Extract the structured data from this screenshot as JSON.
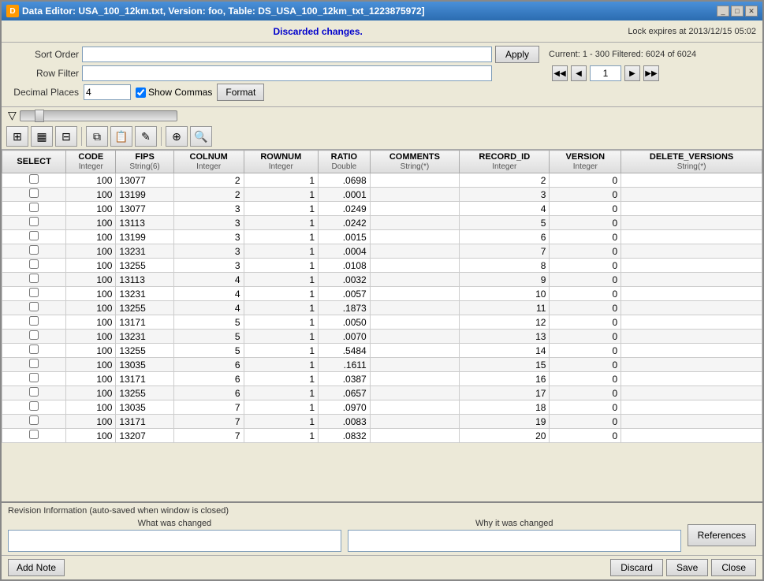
{
  "window": {
    "title": "Data Editor: USA_100_12km.txt, Version: foo, Table: DS_USA_100_12km_txt_1223875972]",
    "icon": "D"
  },
  "title_controls": [
    "_",
    "□",
    "✕"
  ],
  "top_bar": {
    "message": "Discarded changes.",
    "lock_info": "Lock expires at 2013/12/15 05:02"
  },
  "sort_order": {
    "label": "Sort Order",
    "value": "",
    "placeholder": ""
  },
  "row_filter": {
    "label": "Row Filter",
    "value": "",
    "placeholder": ""
  },
  "apply_button": "Apply",
  "navigation": {
    "current_info": "Current: 1 - 300  Filtered: 6024 of 6024",
    "page_value": "1",
    "first_label": "◀◀",
    "prev_label": "◀",
    "next_label": "▶",
    "last_label": "▶▶"
  },
  "decimal_places": {
    "label": "Decimal Places",
    "value": "4"
  },
  "show_commas": {
    "label": "Show Commas",
    "checked": true
  },
  "format_button": "Format",
  "toolbar_buttons": [
    {
      "name": "grid-icon",
      "symbol": "⊞"
    },
    {
      "name": "table-icon",
      "symbol": "▦"
    },
    {
      "name": "table2-icon",
      "symbol": "⊟"
    },
    {
      "name": "copy-icon",
      "symbol": "⧉"
    },
    {
      "name": "paste-icon",
      "symbol": "📋"
    },
    {
      "name": "edit-icon",
      "symbol": "✎"
    },
    {
      "name": "split-icon",
      "symbol": "⊕"
    },
    {
      "name": "search-icon",
      "symbol": "🔍"
    }
  ],
  "table": {
    "columns": [
      {
        "name": "SELECT",
        "type": ""
      },
      {
        "name": "CODE",
        "type": "Integer"
      },
      {
        "name": "FIPS",
        "type": "String(6)"
      },
      {
        "name": "COLNUM",
        "type": "Integer"
      },
      {
        "name": "ROWNUM",
        "type": "Integer"
      },
      {
        "name": "RATIO",
        "type": "Double"
      },
      {
        "name": "COMMENTS",
        "type": "String(*)"
      },
      {
        "name": "RECORD_ID",
        "type": "Integer"
      },
      {
        "name": "VERSION",
        "type": "Integer"
      },
      {
        "name": "DELETE_VERSIONS",
        "type": "String(*)"
      }
    ],
    "rows": [
      [
        false,
        100,
        13077,
        2,
        1,
        ".0698",
        "",
        2,
        0,
        ""
      ],
      [
        false,
        100,
        13199,
        2,
        1,
        ".0001",
        "",
        3,
        0,
        ""
      ],
      [
        false,
        100,
        13077,
        3,
        1,
        ".0249",
        "",
        4,
        0,
        ""
      ],
      [
        false,
        100,
        13113,
        3,
        1,
        ".0242",
        "",
        5,
        0,
        ""
      ],
      [
        false,
        100,
        13199,
        3,
        1,
        ".0015",
        "",
        6,
        0,
        ""
      ],
      [
        false,
        100,
        13231,
        3,
        1,
        ".0004",
        "",
        7,
        0,
        ""
      ],
      [
        false,
        100,
        13255,
        3,
        1,
        ".0108",
        "",
        8,
        0,
        ""
      ],
      [
        false,
        100,
        13113,
        4,
        1,
        ".0032",
        "",
        9,
        0,
        ""
      ],
      [
        false,
        100,
        13231,
        4,
        1,
        ".0057",
        "",
        10,
        0,
        ""
      ],
      [
        false,
        100,
        13255,
        4,
        1,
        ".1873",
        "",
        11,
        0,
        ""
      ],
      [
        false,
        100,
        13171,
        5,
        1,
        ".0050",
        "",
        12,
        0,
        ""
      ],
      [
        false,
        100,
        13231,
        5,
        1,
        ".0070",
        "",
        13,
        0,
        ""
      ],
      [
        false,
        100,
        13255,
        5,
        1,
        ".5484",
        "",
        14,
        0,
        ""
      ],
      [
        false,
        100,
        13035,
        6,
        1,
        ".1611",
        "",
        15,
        0,
        ""
      ],
      [
        false,
        100,
        13171,
        6,
        1,
        ".0387",
        "",
        16,
        0,
        ""
      ],
      [
        false,
        100,
        13255,
        6,
        1,
        ".0657",
        "",
        17,
        0,
        ""
      ],
      [
        false,
        100,
        13035,
        7,
        1,
        ".0970",
        "",
        18,
        0,
        ""
      ],
      [
        false,
        100,
        13171,
        7,
        1,
        ".0083",
        "",
        19,
        0,
        ""
      ],
      [
        false,
        100,
        13207,
        7,
        1,
        ".0832",
        "",
        20,
        0,
        ""
      ]
    ]
  },
  "revision": {
    "title": "Revision Information (auto-saved when window is closed)",
    "what_label": "What was changed",
    "why_label": "Why it was changed",
    "what_value": "",
    "why_value": "",
    "references_button": "References"
  },
  "bottom_bar": {
    "add_note": "Add Note",
    "discard": "Discard",
    "save": "Save",
    "close": "Close"
  }
}
